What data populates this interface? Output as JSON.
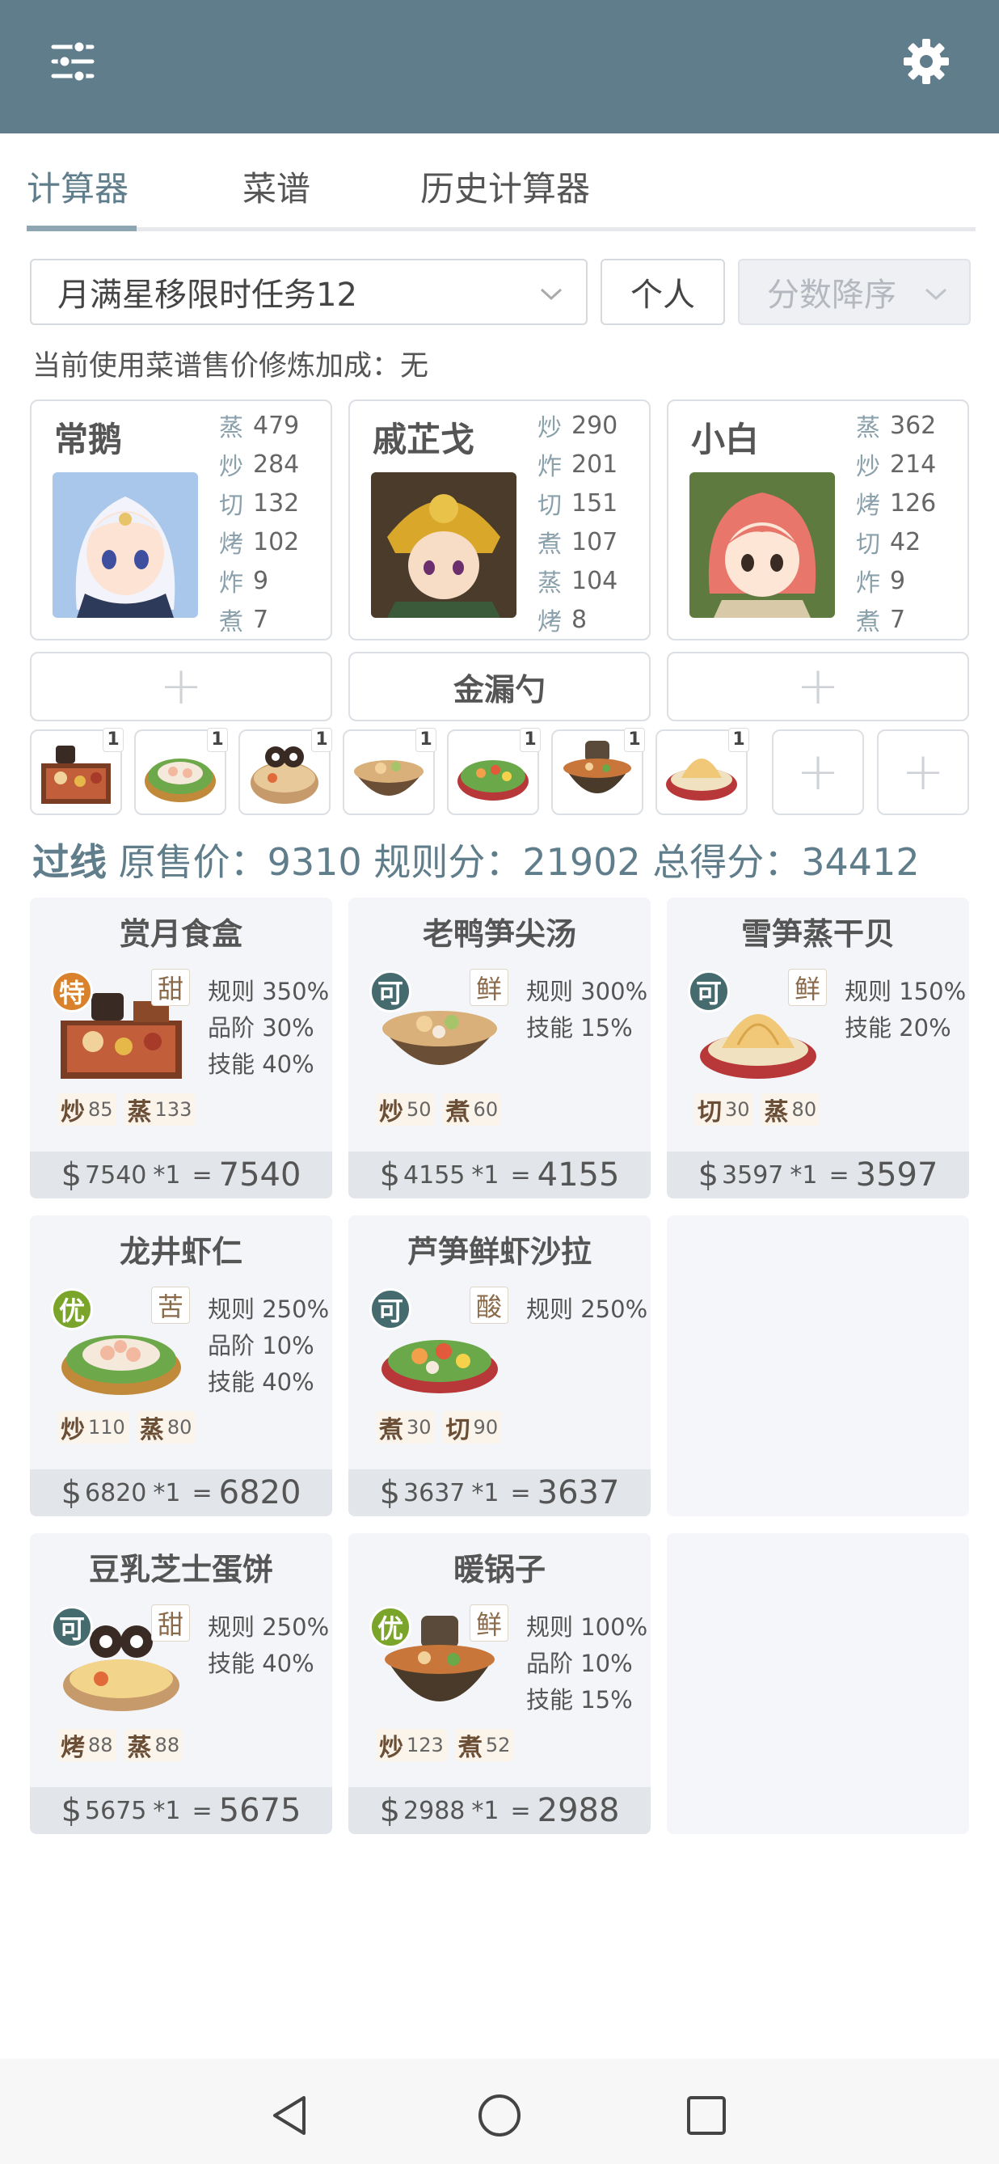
{
  "header": {
    "left_icon": "sliders-icon",
    "right_icon": "gear-icon",
    "bg": "#607d8b"
  },
  "tabs": [
    {
      "label": "计算器",
      "active": true
    },
    {
      "label": "菜谱",
      "active": false
    },
    {
      "label": "历史计算器",
      "active": false
    }
  ],
  "controls": {
    "task_select": "月满星移限时任务12",
    "mode_button": "个人",
    "sort_select": "分数降序"
  },
  "note": "当前使用菜谱售价修炼加成：无",
  "chefs": [
    {
      "name": "常鹅",
      "skills": [
        {
          "k": "蒸",
          "v": "479"
        },
        {
          "k": "炒",
          "v": "284"
        },
        {
          "k": "切",
          "v": "132"
        },
        {
          "k": "烤",
          "v": "102"
        },
        {
          "k": "炸",
          "v": "9"
        },
        {
          "k": "煮",
          "v": "7"
        }
      ]
    },
    {
      "name": "戚芷戈",
      "skills": [
        {
          "k": "炒",
          "v": "290"
        },
        {
          "k": "炸",
          "v": "201"
        },
        {
          "k": "切",
          "v": "151"
        },
        {
          "k": "煮",
          "v": "107"
        },
        {
          "k": "蒸",
          "v": "104"
        },
        {
          "k": "烤",
          "v": "8"
        }
      ]
    },
    {
      "name": "小白",
      "skills": [
        {
          "k": "蒸",
          "v": "362"
        },
        {
          "k": "炒",
          "v": "214"
        },
        {
          "k": "烤",
          "v": "126"
        },
        {
          "k": "切",
          "v": "42"
        },
        {
          "k": "炸",
          "v": "9"
        },
        {
          "k": "煮",
          "v": "7"
        }
      ]
    }
  ],
  "equipment": [
    "+",
    "金漏勺",
    "+"
  ],
  "dish_slots": [
    {
      "icon": "bento-box-icon",
      "qty": "1"
    },
    {
      "icon": "shrimp-plate-icon",
      "qty": "1"
    },
    {
      "icon": "duck-soup-icon",
      "qty": "1"
    },
    {
      "icon": "scallop-bowl-icon",
      "qty": "1"
    },
    {
      "icon": "salad-plate-icon",
      "qty": "1"
    },
    {
      "icon": "hotpot-icon",
      "qty": "1"
    },
    {
      "icon": "custard-plate-icon",
      "qty": "1"
    },
    {
      "icon": "plus-icon",
      "qty": ""
    },
    {
      "icon": "plus-icon",
      "qty": ""
    }
  ],
  "summary": {
    "status": "过线",
    "text": "原售价：9310 规则分：21902 总得分：34412"
  },
  "recipes": [
    {
      "title": "赏月食盒",
      "grade": "特",
      "grade_color": "#d9822b",
      "flavor": "甜",
      "bonuses": [
        "规则 350%",
        "品阶 30%",
        "技能 40%"
      ],
      "reqs": [
        {
          "k": "炒",
          "v": "85"
        },
        {
          "k": "蒸",
          "v": "133"
        }
      ],
      "dollar": "$",
      "price": "7540",
      "mult": "*1",
      "eq": "=",
      "total": "7540",
      "dish": "bento"
    },
    {
      "title": "老鸭笋尖汤",
      "grade": "可",
      "grade_color": "#456b6e",
      "flavor": "鲜",
      "bonuses": [
        "规则 300%",
        "技能 15%"
      ],
      "reqs": [
        {
          "k": "炒",
          "v": "50"
        },
        {
          "k": "煮",
          "v": "60"
        }
      ],
      "dollar": "$",
      "price": "4155",
      "mult": "*1",
      "eq": "=",
      "total": "4155",
      "dish": "soup"
    },
    {
      "title": "雪笋蒸干贝",
      "grade": "可",
      "grade_color": "#456b6e",
      "flavor": "鲜",
      "bonuses": [
        "规则 150%",
        "技能 20%"
      ],
      "reqs": [
        {
          "k": "切",
          "v": "30"
        },
        {
          "k": "蒸",
          "v": "80"
        }
      ],
      "dollar": "$",
      "price": "3597",
      "mult": "*1",
      "eq": "=",
      "total": "3597",
      "dish": "custard"
    },
    {
      "title": "龙井虾仁",
      "grade": "优",
      "grade_color": "#7aa52a",
      "flavor": "苦",
      "bonuses": [
        "规则 250%",
        "品阶 10%",
        "技能 40%"
      ],
      "reqs": [
        {
          "k": "炒",
          "v": "110"
        },
        {
          "k": "蒸",
          "v": "80"
        }
      ],
      "dollar": "$",
      "price": "6820",
      "mult": "*1",
      "eq": "=",
      "total": "6820",
      "dish": "shrimp"
    },
    {
      "title": "芦笋鲜虾沙拉",
      "grade": "可",
      "grade_color": "#456b6e",
      "flavor": "酸",
      "bonuses": [
        "规则 250%"
      ],
      "reqs": [
        {
          "k": "煮",
          "v": "30"
        },
        {
          "k": "切",
          "v": "90"
        }
      ],
      "dollar": "$",
      "price": "3637",
      "mult": "*1",
      "eq": "=",
      "total": "3637",
      "dish": "salad"
    },
    {
      "title": "",
      "empty": true
    },
    {
      "title": "豆乳芝士蛋饼",
      "grade": "可",
      "grade_color": "#456b6e",
      "flavor": "甜",
      "bonuses": [
        "规则 250%",
        "技能 40%"
      ],
      "reqs": [
        {
          "k": "烤",
          "v": "88"
        },
        {
          "k": "蒸",
          "v": "88"
        }
      ],
      "dollar": "$",
      "price": "5675",
      "mult": "*1",
      "eq": "=",
      "total": "5675",
      "dish": "omelette"
    },
    {
      "title": "暖锅子",
      "grade": "优",
      "grade_color": "#7aa52a",
      "flavor": "鲜",
      "bonuses": [
        "规则 100%",
        "品阶 10%",
        "技能 15%"
      ],
      "reqs": [
        {
          "k": "炒",
          "v": "123"
        },
        {
          "k": "煮",
          "v": "52"
        }
      ],
      "dollar": "$",
      "price": "2988",
      "mult": "*1",
      "eq": "=",
      "total": "2988",
      "dish": "hotpot"
    },
    {
      "title": "",
      "empty": true
    }
  ],
  "navbar": {
    "back": "back-triangle-icon",
    "home": "home-circle-icon",
    "recents": "recents-square-icon"
  }
}
